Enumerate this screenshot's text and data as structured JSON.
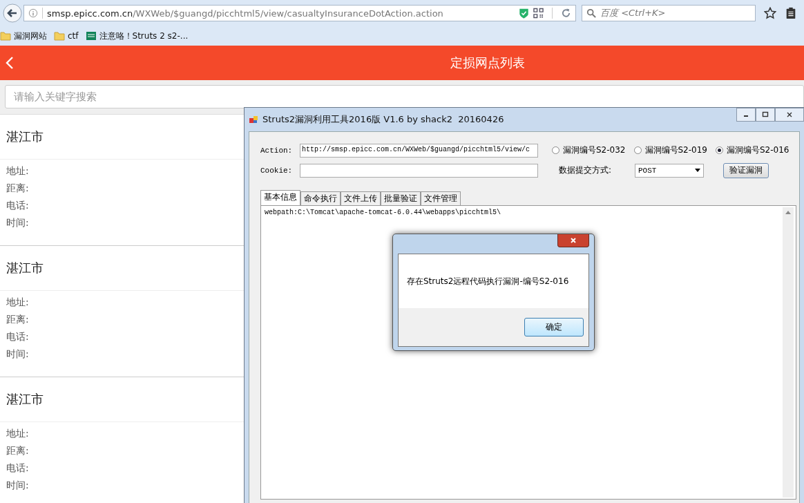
{
  "browser": {
    "url_host": "smsp.epicc.com.cn",
    "url_path": "/WXWeb/$guangd/picchtml5/view/casualtyInsuranceDotAction.action",
    "search_placeholder": "百度 <Ctrl+K>",
    "bookmarks": [
      {
        "label": "漏洞网站",
        "kind": "folder"
      },
      {
        "label": "ctf",
        "kind": "folder"
      },
      {
        "label": "注意咯！Struts 2 s2-...",
        "kind": "site"
      }
    ]
  },
  "page": {
    "title": "定损网点列表",
    "search_placeholder": "请输入关键字搜索",
    "items": [
      {
        "city": "湛江市",
        "fields": [
          "地址:",
          "距离:",
          "电话:",
          "时间:"
        ]
      },
      {
        "city": "湛江市",
        "fields": [
          "地址:",
          "距离:",
          "电话:",
          "时间:"
        ]
      },
      {
        "city": "湛江市",
        "fields": [
          "地址:",
          "距离:",
          "电话:",
          "时间:"
        ]
      }
    ]
  },
  "tool_window": {
    "title": "Struts2漏洞利用工具2016版 V1.6 by shack2  20160426",
    "action_label": "Action:",
    "action_value": "http://smsp.epicc.com.cn/WXWeb/$guangd/picchtml5/view/c",
    "cookie_label": "Cookie:",
    "options": [
      {
        "label": "漏洞编号S2-032",
        "selected": false
      },
      {
        "label": "漏洞编号S2-019",
        "selected": false
      },
      {
        "label": "漏洞编号S2-016",
        "selected": true
      }
    ],
    "method_label": "数据提交方式:",
    "method_value": "POST",
    "verify_button": "验证漏洞",
    "tabs": [
      {
        "label": "基本信息",
        "selected": true
      },
      {
        "label": "命令执行",
        "selected": false
      },
      {
        "label": "文件上传",
        "selected": false
      },
      {
        "label": "批量验证",
        "selected": false
      },
      {
        "label": "文件管理",
        "selected": false
      }
    ],
    "output": "webpath:C:\\Tomcat\\apache-tomcat-6.0.44\\webapps\\picchtml5\\"
  },
  "dialog": {
    "message": "存在Struts2远程代码执行漏洞-编号S2-016",
    "ok_button": "确定"
  }
}
